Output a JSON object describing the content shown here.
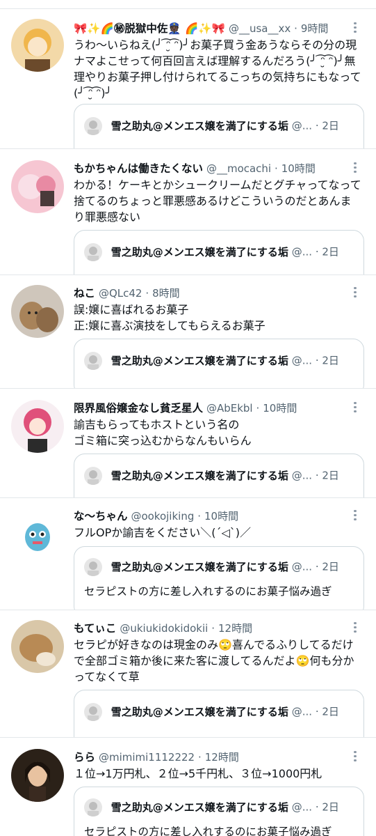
{
  "tweets": [
    {
      "name": "🎀✨🌈㊙脱獄中佐👮🏿 🌈✨🎀",
      "handle": "@__usa__xx",
      "time": "9時間",
      "text": "うわ〜いらねえ(╯ ͡ᵔ̮ ͡ᵔ)╯お菓子買う金あうならその分の現ナマよこせって何百回言えば理解するんだろう(╯ ͡ᵔ̮ ͡ᵔ)╯無理やりお菓子押し付けられてるこっちの気持ちにもなって(╯ ͡ᵔ̮ ͡ᵔ)╯",
      "quote": {
        "name": "雪之助丸@メンエス嬢を満了にする垢",
        "handle": "@...",
        "time": "2日",
        "text": ""
      }
    },
    {
      "name": "もかちゃんは働きたくない",
      "handle": "@__mocachi",
      "time": "10時間",
      "text": "わかる！ケーキとかシュークリームだとグチャってなって捨てるのちょっと罪悪感あるけどこういうのだとあんまり罪悪感ない",
      "quote": {
        "name": "雪之助丸@メンエス嬢を満了にする垢",
        "handle": "@...",
        "time": "2日",
        "text": ""
      }
    },
    {
      "name": "ねこ",
      "handle": "@QLc42",
      "time": "8時間",
      "text": "誤:嬢に喜ばれるお菓子\n正:嬢に喜ぶ演技をしてもらえるお菓子",
      "quote": {
        "name": "雪之助丸@メンエス嬢を満了にする垢",
        "handle": "@...",
        "time": "2日",
        "text": ""
      }
    },
    {
      "name": "限界風俗嬢金なし貧乏星人",
      "handle": "@AbEkbl",
      "time": "10時間",
      "text": "諭吉もらってもホストという名の\nゴミ箱に突っ込むからなんもいらん",
      "quote": {
        "name": "雪之助丸@メンエス嬢を満了にする垢",
        "handle": "@...",
        "time": "2日",
        "text": ""
      }
    },
    {
      "name": "な〜ちゃん",
      "handle": "@ookojiking",
      "time": "10時間",
      "text": "フルOPか諭吉をください＼(´◁`)／",
      "quote": {
        "name": "雪之助丸@メンエス嬢を満了にする垢",
        "handle": "@...",
        "time": "2日",
        "text": "セラピストの方に差し入れするのにお菓子悩み過ぎ"
      }
    },
    {
      "name": "もてぃこ",
      "handle": "@ukiukidokidokii",
      "time": "12時間",
      "text": "セラピが好きなのは現金のみ🙄喜んでるふりしてるだけで全部ゴミ箱か後に来た客に渡してるんだよ🙄何も分かってなくて草",
      "quote": {
        "name": "雪之助丸@メンエス嬢を満了にする垢",
        "handle": "@...",
        "time": "2日",
        "text": ""
      }
    },
    {
      "name": "らら",
      "handle": "@mimimi1112222",
      "time": "12時間",
      "text": "１位→1万円札、２位→5千円札、３位→1000円札",
      "quote": {
        "name": "雪之助丸@メンエス嬢を満了にする垢",
        "handle": "@...",
        "time": "2日",
        "text": "セラピストの方に差し入れするのにお菓子悩み過ぎ"
      }
    }
  ],
  "separator": "·",
  "icons": {
    "avatar": "avatar-icon",
    "more": "more-options-icon",
    "quote_avatar": "quote-avatar-icon"
  }
}
